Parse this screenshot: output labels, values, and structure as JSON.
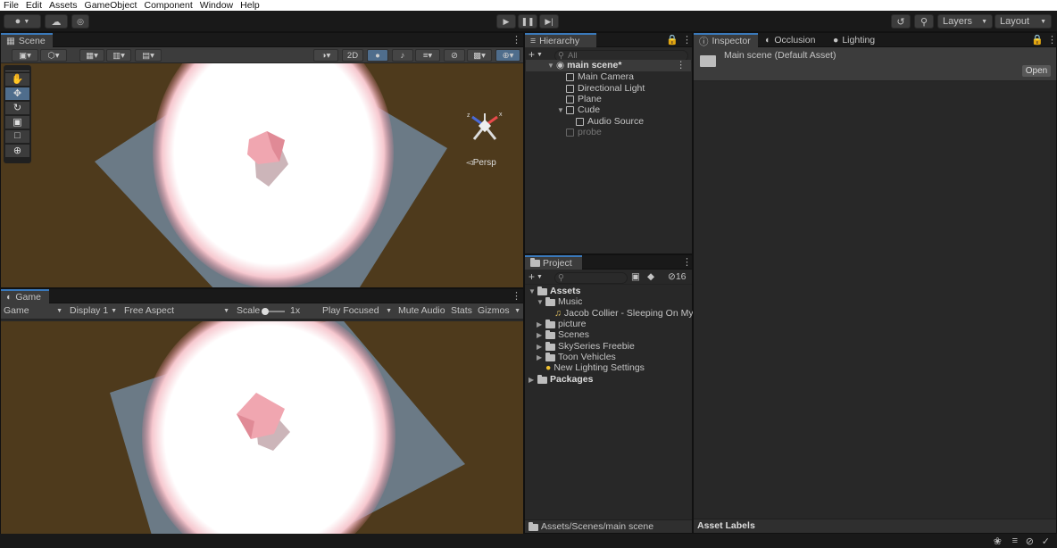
{
  "menu": [
    "File",
    "Edit",
    "Assets",
    "GameObject",
    "Component",
    "Window",
    "Help"
  ],
  "toolbar": {
    "layers": "Layers",
    "layout": "Layout"
  },
  "scene": {
    "tab": "Scene",
    "btn_2d": "2D",
    "persp": "◅Persp"
  },
  "game": {
    "tab": "Game",
    "mode": "Game",
    "display": "Display 1",
    "aspect": "Free Aspect",
    "scale_label": "Scale",
    "scale_value": "1x",
    "play_focused": "Play Focused",
    "mute_audio": "Mute Audio",
    "stats": "Stats",
    "gizmos": "Gizmos"
  },
  "hierarchy": {
    "tab": "Hierarchy",
    "search_placeholder": "All",
    "root": "main scene*",
    "items": [
      {
        "label": "Main Camera"
      },
      {
        "label": "Directional Light"
      },
      {
        "label": "Plane"
      },
      {
        "label": "Cude"
      },
      {
        "label": "Audio Source"
      },
      {
        "label": "probe"
      }
    ]
  },
  "project": {
    "tab": "Project",
    "hidden_count": "16",
    "tree": [
      {
        "label": "Assets"
      },
      {
        "label": "Music"
      },
      {
        "label": "Jacob Collier - Sleeping On My"
      },
      {
        "label": "picture"
      },
      {
        "label": "Scenes"
      },
      {
        "label": "SkySeries Freebie"
      },
      {
        "label": "Toon Vehicles"
      },
      {
        "label": "New Lighting Settings"
      },
      {
        "label": "Packages"
      }
    ],
    "path": "Assets/Scenes/main scene"
  },
  "inspector": {
    "tabs": [
      "Inspector",
      "Occlusion",
      "Lighting"
    ],
    "asset_title": "Main scene (Default Asset)",
    "open_button": "Open",
    "asset_labels": "Asset Labels"
  },
  "colors": {
    "accent": "#3a79bb",
    "panel": "#282828",
    "ground": "#4e3a1c"
  }
}
